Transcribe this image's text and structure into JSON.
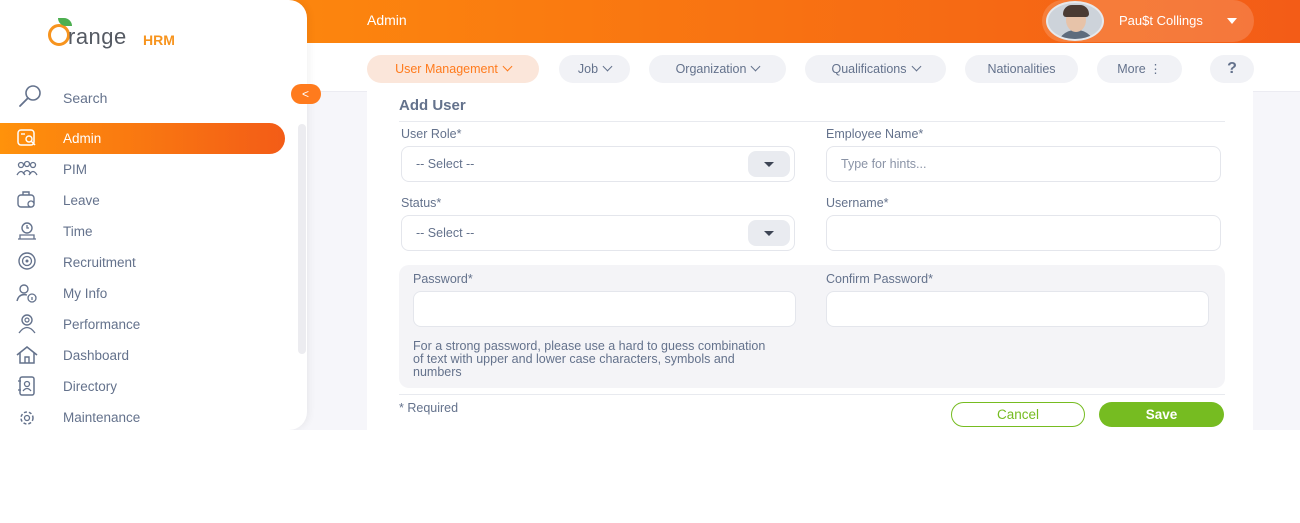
{
  "header": {
    "module_title": "Admin",
    "user_name": "Pau$t Collings"
  },
  "brand": {
    "logo_text_main": "range",
    "logo_text_hrm": "HRM",
    "accent_color": "#ff7b1d",
    "success_color": "#76bc21"
  },
  "top_nav": {
    "tabs": [
      {
        "label": "User Management",
        "icon": "chevron-down-icon"
      },
      {
        "label": "Job",
        "icon": "chevron-down-icon"
      },
      {
        "label": "Organization",
        "icon": "chevron-down-icon"
      },
      {
        "label": "Qualifications",
        "icon": "chevron-down-icon"
      },
      {
        "label": "Nationalities"
      },
      {
        "label": "More ⋮"
      }
    ],
    "help_label": "?"
  },
  "sidebar": {
    "collapse_label": "<",
    "search_label": "Search",
    "items": [
      {
        "label": "Admin",
        "icon": "admin-icon"
      },
      {
        "label": "PIM",
        "icon": "people-icon"
      },
      {
        "label": "Leave",
        "icon": "leave-icon"
      },
      {
        "label": "Time",
        "icon": "time-icon"
      },
      {
        "label": "Recruitment",
        "icon": "recruitment-icon"
      },
      {
        "label": "My Info",
        "icon": "my-info-icon"
      },
      {
        "label": "Performance",
        "icon": "performance-icon"
      },
      {
        "label": "Dashboard",
        "icon": "home-icon"
      },
      {
        "label": "Directory",
        "icon": "directory-icon"
      },
      {
        "label": "Maintenance",
        "icon": "maintenance-icon"
      }
    ]
  },
  "form": {
    "title": "Add User",
    "user_role_label": "User Role*",
    "user_role_value": "-- Select --",
    "employee_name_label": "Employee Name*",
    "employee_name_placeholder": "Type for hints...",
    "status_label": "Status*",
    "status_value": "-- Select --",
    "username_label": "Username*",
    "username_value": "",
    "password_label": "Password*",
    "confirm_password_label": "Confirm Password*",
    "password_hint": "For a strong password, please use a hard to guess combination of text with upper and lower case characters, symbols and numbers",
    "required_note": "* Required",
    "cancel_label": "Cancel",
    "save_label": "Save"
  }
}
